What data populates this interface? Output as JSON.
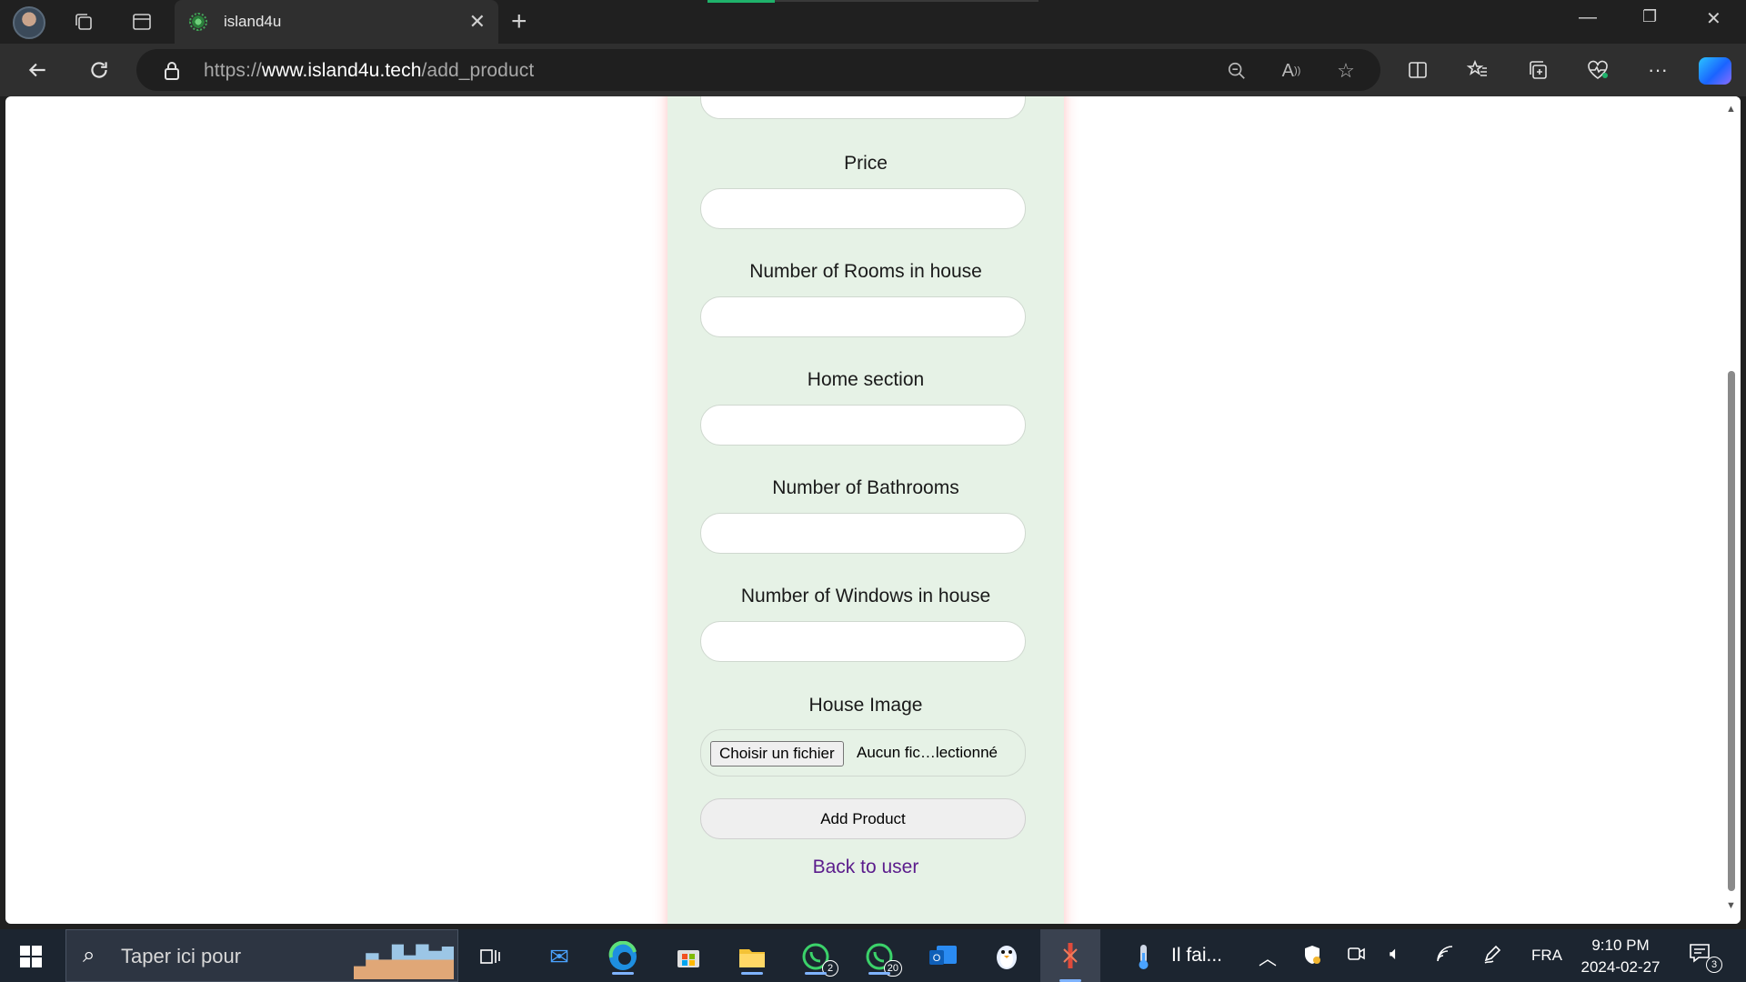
{
  "browser": {
    "tab_title": "island4u",
    "url_prefix": "https://",
    "url_domain": "www.island4u.tech",
    "url_path": "/add_product"
  },
  "form": {
    "fields": [
      {
        "label": "Price"
      },
      {
        "label": "Number of Rooms in house"
      },
      {
        "label": "Home section"
      },
      {
        "label": "Number of Bathrooms"
      },
      {
        "label": "Number of Windows in house"
      }
    ],
    "image_label": "House Image",
    "file_button": "Choisir un fichier",
    "file_status": "Aucun fic…lectionné",
    "submit_label": "Add Product",
    "back_link": "Back to user"
  },
  "taskbar": {
    "search_placeholder": "Taper ici pour",
    "whatsapp_badge": "2",
    "whatsapp_business_badge": "20",
    "weather_text": "Il fai...",
    "language": "FRA",
    "time": "9:10 PM",
    "date": "2024-02-27",
    "notification_count": "3"
  },
  "colors": {
    "panel_bg": "#e6f2e6",
    "link": "#5b1c8c",
    "tab_loading": "#1fb26b"
  }
}
